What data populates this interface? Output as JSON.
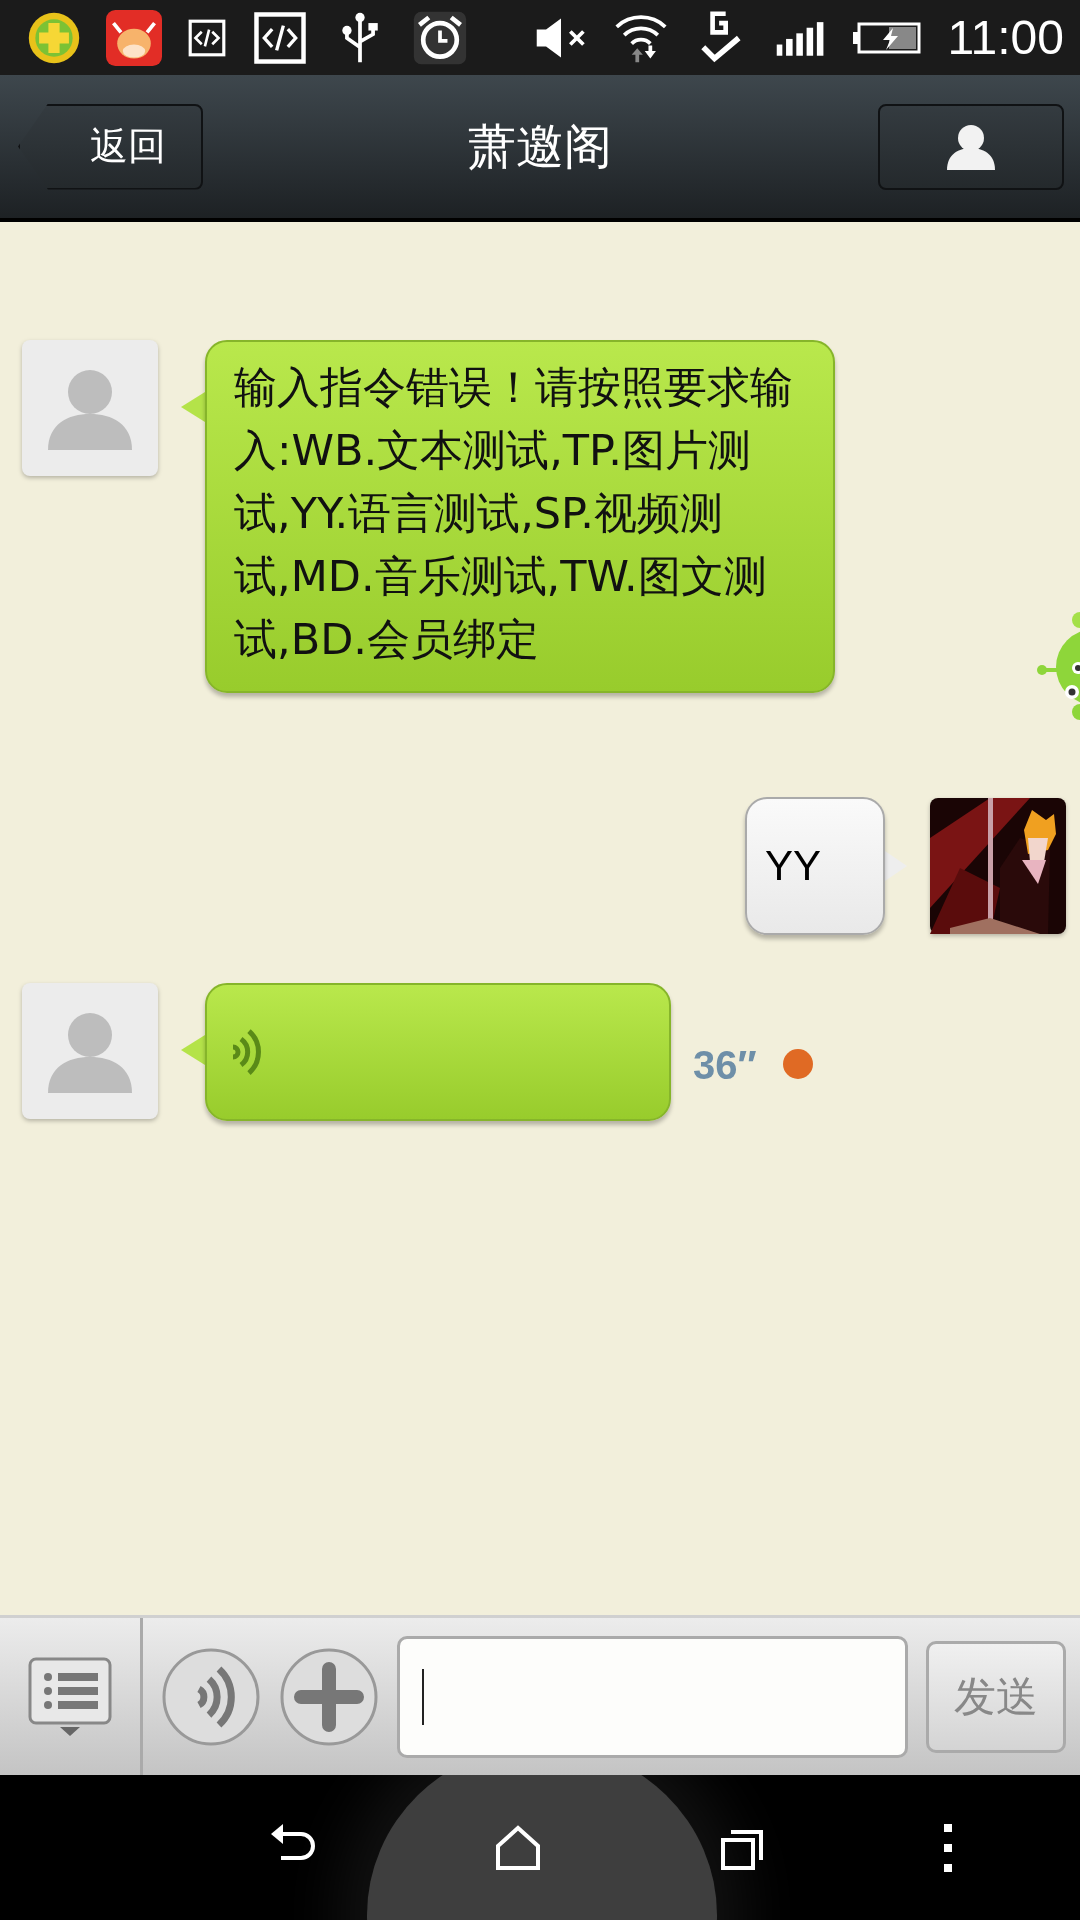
{
  "status_bar": {
    "time": "11:00"
  },
  "header": {
    "back": "返回",
    "title": "萧邀阁"
  },
  "messages": [
    {
      "kind": "text",
      "from_me": false,
      "text": "输入指令错误！请按照要求输入:WB.文本测试,TP.图片测试,YY.语言测试,SP.视频测试,MD.音乐测试,TW.图文测试,BD.会员绑定"
    },
    {
      "kind": "text",
      "from_me": true,
      "text": "YY"
    },
    {
      "kind": "voice",
      "from_me": false,
      "duration": "36″",
      "unread": true
    }
  ],
  "composer": {
    "send": "发送"
  }
}
